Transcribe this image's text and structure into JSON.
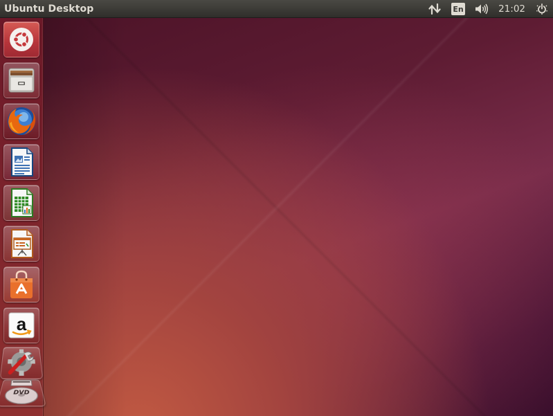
{
  "top_panel": {
    "title": "Ubuntu Desktop",
    "indicators": {
      "network_icon": "network-updown-icon",
      "keyboard_layout": "En",
      "sound_icon": "speaker-volume-icon",
      "clock": "21:02",
      "power_icon": "power-gear-icon"
    }
  },
  "launcher": {
    "items": [
      {
        "name": "dash-home",
        "icon": "ubuntu-logo-icon"
      },
      {
        "name": "files",
        "icon": "file-cabinet-icon"
      },
      {
        "name": "firefox",
        "icon": "firefox-icon"
      },
      {
        "name": "libreoffice-writer",
        "icon": "writer-document-icon"
      },
      {
        "name": "libreoffice-calc",
        "icon": "calc-spreadsheet-icon"
      },
      {
        "name": "libreoffice-impress",
        "icon": "impress-presentation-icon"
      },
      {
        "name": "ubuntu-software-center",
        "icon": "shopping-bag-icon"
      },
      {
        "name": "amazon",
        "icon": "amazon-logo-icon"
      },
      {
        "name": "system-settings",
        "icon": "settings-wrench-icon"
      },
      {
        "name": "dvd-drive",
        "icon": "dvd-disc-icon"
      }
    ],
    "dvd_label": "DVD",
    "amazon_letter": "a"
  },
  "colors": {
    "panel_bg": "#3a3935",
    "panel_text": "#dfdbd2",
    "wallpaper_dark": "#4a1226",
    "wallpaper_light": "#c25a42",
    "ubuntu_orange": "#dd4814"
  }
}
